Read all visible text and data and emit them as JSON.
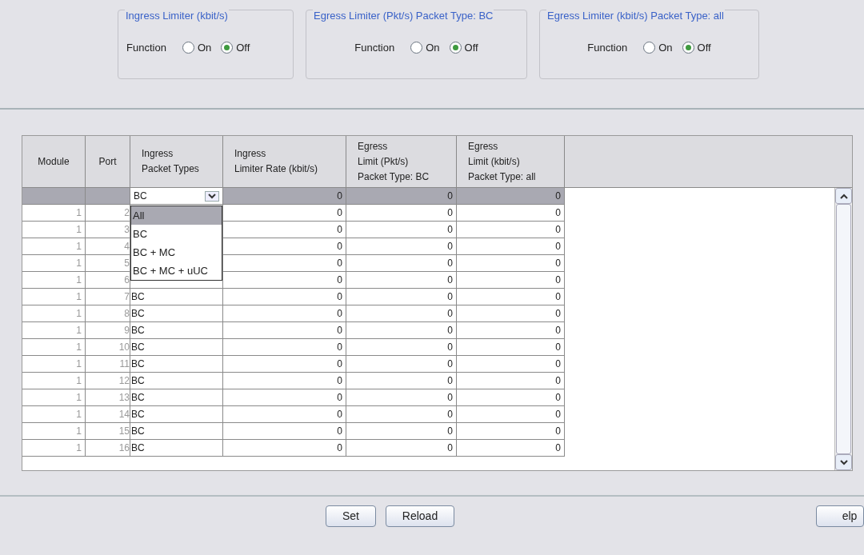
{
  "limiters": [
    {
      "title": "Ingress Limiter (kbit/s)",
      "label": "Function",
      "options": [
        {
          "label": "On",
          "selected": false
        },
        {
          "label": "Off",
          "selected": true
        }
      ]
    },
    {
      "title": "Egress Limiter (Pkt/s) Packet Type: BC",
      "label": "Function",
      "options": [
        {
          "label": "On",
          "selected": false
        },
        {
          "label": "Off",
          "selected": true
        }
      ]
    },
    {
      "title": "Egress Limiter (kbit/s) Packet Type: all",
      "label": "Function",
      "options": [
        {
          "label": "On",
          "selected": false
        },
        {
          "label": "Off",
          "selected": true
        }
      ]
    }
  ],
  "table": {
    "columns": [
      [
        "Module"
      ],
      [
        "Port"
      ],
      [
        "Ingress",
        "Packet Types"
      ],
      [
        "Ingress",
        "Limiter Rate (kbit/s)"
      ],
      [
        "Egress",
        "Limit (Pkt/s)",
        "Packet Type: BC"
      ],
      [
        "Egress",
        "Limit (kbit/s)",
        "Packet Type: all"
      ]
    ],
    "filter_row": {
      "packet_type": "BC",
      "rate": "0",
      "egress_pkt": "0",
      "egress_kbit": "0"
    },
    "dropdown": [
      {
        "label": "All",
        "selected": true
      },
      {
        "label": "BC",
        "selected": false
      },
      {
        "label": "BC + MC",
        "selected": false
      },
      {
        "label": "BC + MC + uUC",
        "selected": false
      }
    ],
    "rows": [
      {
        "module": "1",
        "port": "2",
        "rate": "0",
        "egress_pkt": "0",
        "egress_kbit": "0"
      },
      {
        "module": "1",
        "port": "3",
        "rate": "0",
        "egress_pkt": "0",
        "egress_kbit": "0"
      },
      {
        "module": "1",
        "port": "4",
        "rate": "0",
        "egress_pkt": "0",
        "egress_kbit": "0"
      },
      {
        "module": "1",
        "port": "5",
        "rate": "0",
        "egress_pkt": "0",
        "egress_kbit": "0"
      },
      {
        "module": "1",
        "port": "6",
        "rate": "0",
        "egress_pkt": "0",
        "egress_kbit": "0"
      },
      {
        "module": "1",
        "port": "7",
        "packet_type": "BC",
        "rate": "0",
        "egress_pkt": "0",
        "egress_kbit": "0"
      },
      {
        "module": "1",
        "port": "8",
        "packet_type": "BC",
        "rate": "0",
        "egress_pkt": "0",
        "egress_kbit": "0"
      },
      {
        "module": "1",
        "port": "9",
        "packet_type": "BC",
        "rate": "0",
        "egress_pkt": "0",
        "egress_kbit": "0"
      },
      {
        "module": "1",
        "port": "10",
        "packet_type": "BC",
        "rate": "0",
        "egress_pkt": "0",
        "egress_kbit": "0"
      },
      {
        "module": "1",
        "port": "11",
        "packet_type": "BC",
        "rate": "0",
        "egress_pkt": "0",
        "egress_kbit": "0"
      },
      {
        "module": "1",
        "port": "12",
        "packet_type": "BC",
        "rate": "0",
        "egress_pkt": "0",
        "egress_kbit": "0"
      },
      {
        "module": "1",
        "port": "13",
        "packet_type": "BC",
        "rate": "0",
        "egress_pkt": "0",
        "egress_kbit": "0"
      },
      {
        "module": "1",
        "port": "14",
        "packet_type": "BC",
        "rate": "0",
        "egress_pkt": "0",
        "egress_kbit": "0"
      },
      {
        "module": "1",
        "port": "15",
        "packet_type": "BC",
        "rate": "0",
        "egress_pkt": "0",
        "egress_kbit": "0"
      },
      {
        "module": "1",
        "port": "16",
        "packet_type": "BC",
        "rate": "0",
        "egress_pkt": "0",
        "egress_kbit": "0"
      }
    ]
  },
  "buttons": [
    "Set",
    "Reload",
    "elp"
  ]
}
